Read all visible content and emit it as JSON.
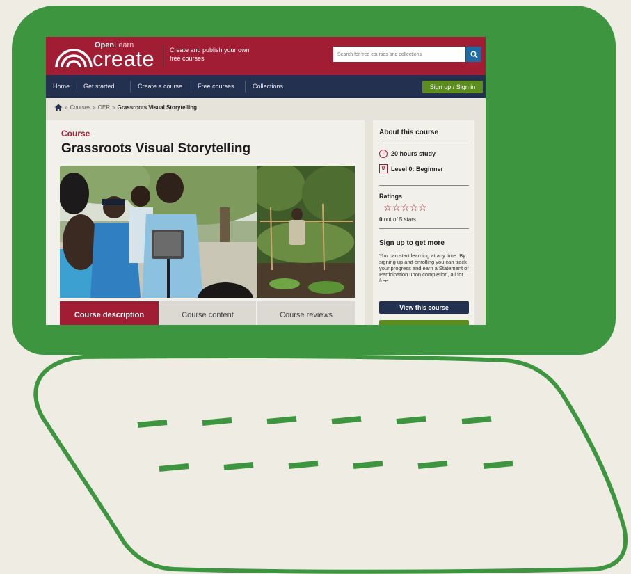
{
  "colors": {
    "laptop_green": "#3e9540",
    "brand_red": "#a11d34",
    "nav_navy": "#23304f",
    "signin_green": "#5d8d1e",
    "search_blue": "#1c6aa6"
  },
  "header": {
    "brand_open": "Open",
    "brand_learn": "Learn",
    "brand_main": "create",
    "tagline": "Create and publish your own free courses",
    "search_placeholder": "Search for free courses and collections",
    "search_icon": "search-icon"
  },
  "nav": {
    "items": [
      "Home",
      "Get started",
      "Create a course",
      "Free courses",
      "Collections"
    ],
    "sign_in": "Sign up / Sign in"
  },
  "breadcrumb": {
    "home_icon": "home-icon",
    "items": [
      "Courses",
      "OER"
    ],
    "current": "Grassroots Visual Storytelling",
    "separator": "»"
  },
  "course": {
    "kicker": "Course",
    "title": "Grassroots Visual Storytelling",
    "tabs": [
      "Course description",
      "Course content",
      "Course reviews"
    ]
  },
  "sidebar": {
    "about_heading": "About this course",
    "study_time": "20 hours study",
    "level_badge": "0",
    "level": "Level 0: Beginner",
    "ratings_heading": "Ratings",
    "stars": "☆☆☆☆☆",
    "rating_value": "0",
    "rating_text": "out of 5 stars",
    "signup_heading": "Sign up to get more",
    "signup_body": "You can start learning at any time. By signing up and enrolling you can track your progress and earn a Statement of Participation upon completion, all for free.",
    "view_button": "View this course"
  }
}
